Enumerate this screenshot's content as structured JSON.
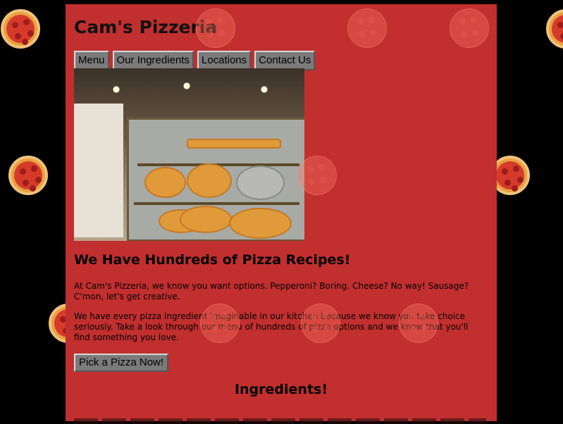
{
  "site": {
    "title": "Cam's Pizzeria"
  },
  "nav": {
    "items": [
      {
        "label": "Menu"
      },
      {
        "label": "Our Ingredients"
      },
      {
        "label": "Locations"
      },
      {
        "label": "Contact Us"
      }
    ]
  },
  "main": {
    "headline": "We Have Hundreds of Pizza Recipes!",
    "paragraph_1": "At Cam's Pizzeria, we know you want options. Pepperoni? Boring. Cheese? No way! Sausage? C'mon, let's get creative.",
    "paragraph_2": "We have every pizza ingredient imaginable in our kitchen because we know you take choice seriously. Take a look through our menu of hundreds of pizza options and we know that you'll find something you love.",
    "cta_label": "Pick a Pizza Now!",
    "ingredients_heading": "Ingredients!"
  },
  "colors": {
    "page_background": "#000000",
    "content_background": "#c12f2f",
    "button_background": "#7b7b7b"
  },
  "icons": {
    "background_decoration": "pepperoni-pizza-icon"
  }
}
